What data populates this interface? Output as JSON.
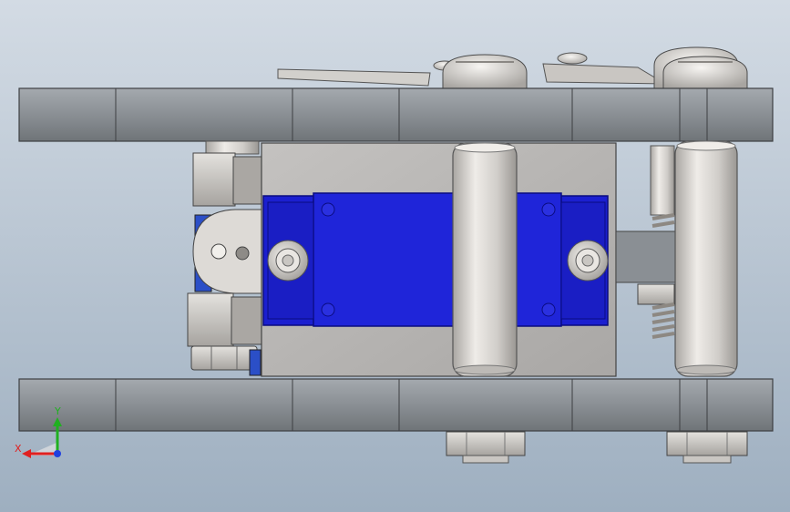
{
  "viewport": {
    "background_top": "#d3dbe4",
    "background_bottom": "#9eafc0"
  },
  "colors": {
    "rail": "#8e9398",
    "rail_dark": "#6f7478",
    "block": "#b8b6b4",
    "servo_blue": "#1b1fd0",
    "servo_blue_dark": "#0c0f9a",
    "pin": "#d6d3cf",
    "bolt": "#dcdad6",
    "spring": "#9a958f",
    "axis_x": "#e02020",
    "axis_y": "#20b020",
    "axis_z": "#2040e0"
  },
  "triad": {
    "x_label": "X",
    "y_label": "Y"
  }
}
